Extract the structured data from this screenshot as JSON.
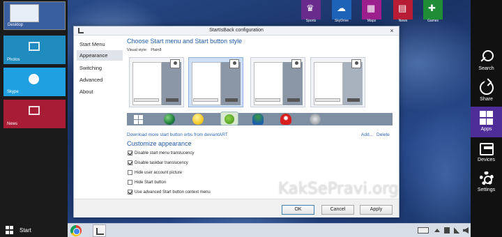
{
  "switcher": {
    "items": [
      {
        "label": "Desktop"
      },
      {
        "label": "Photos"
      },
      {
        "label": "Skype"
      },
      {
        "label": "News"
      }
    ]
  },
  "start": {
    "label": "Start"
  },
  "top_tiles": [
    {
      "label": "Sports",
      "color": "#6a2c8c"
    },
    {
      "label": "SkyDrive",
      "color": "#1d63b8"
    },
    {
      "label": "Maps",
      "color": "#9c1f8e"
    },
    {
      "label": "News",
      "color": "#b71c34"
    },
    {
      "label": "Games",
      "color": "#1f8c36"
    }
  ],
  "charms": [
    {
      "label": "Search",
      "icon": "search-icon"
    },
    {
      "label": "Share",
      "icon": "share-icon"
    },
    {
      "label": "Apps",
      "icon": "apps-icon",
      "active": true,
      "color": "#4e2d99"
    },
    {
      "label": "Devices",
      "icon": "devices-icon"
    },
    {
      "label": "Settings",
      "icon": "gear-icon"
    }
  ],
  "dialog": {
    "title": "StartIsBack configuration",
    "close": "×",
    "nav": [
      {
        "label": "Start Menu"
      },
      {
        "label": "Appearance",
        "active": true
      },
      {
        "label": "Switching"
      },
      {
        "label": "Advanced"
      },
      {
        "label": "About"
      }
    ],
    "section_style": "Choose Start menu and Start button style",
    "visual_style_label": "Visual style:",
    "visual_style_value": "Plain8",
    "download_link": "Download more start button orbs from deviantART",
    "add_link": "Add...",
    "delete_link": "Delete",
    "section_appearance": "Customize appearance",
    "options": [
      {
        "label": "Disable start menu translucency",
        "checked": true
      },
      {
        "label": "Disable taskbar translucency",
        "checked": true
      },
      {
        "label": "Hide user account picture",
        "checked": false
      },
      {
        "label": "Hide Start button",
        "checked": false
      },
      {
        "label": "Use advanced Start button context menu",
        "checked": true
      }
    ],
    "buttons": {
      "ok": "OK",
      "cancel": "Cancel",
      "apply": "Apply"
    }
  },
  "watermark": "KakSePravi.org"
}
